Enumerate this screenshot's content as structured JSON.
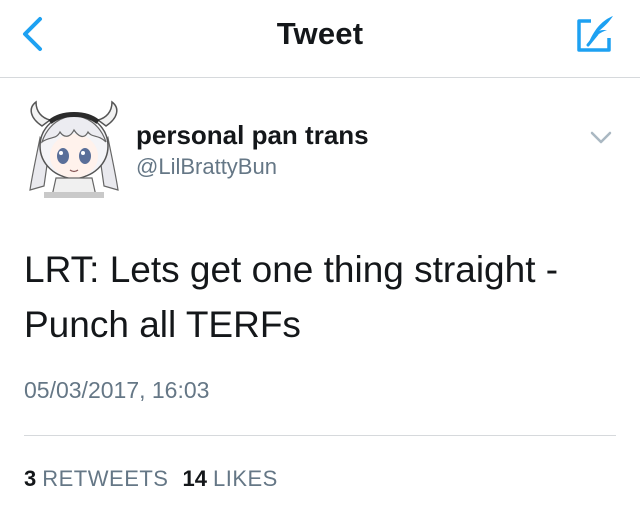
{
  "header": {
    "title": "Tweet",
    "back_icon": "chevron-left-icon",
    "compose_icon": "compose-feather-icon",
    "accent": "#1da1f2"
  },
  "author": {
    "display_name": "personal pan trans",
    "handle": "@LilBrattyBun",
    "avatar_icon": "anime-avatar",
    "menu_icon": "chevron-down-icon"
  },
  "tweet": {
    "line1": "LRT: Lets get one thing straight -",
    "line2": "Punch all TERFs",
    "timestamp": "05/03/2017, 16:03"
  },
  "stats": {
    "retweets_count": "3",
    "retweets_label": "RETWEETS",
    "likes_count": "14",
    "likes_label": "LIKES"
  }
}
